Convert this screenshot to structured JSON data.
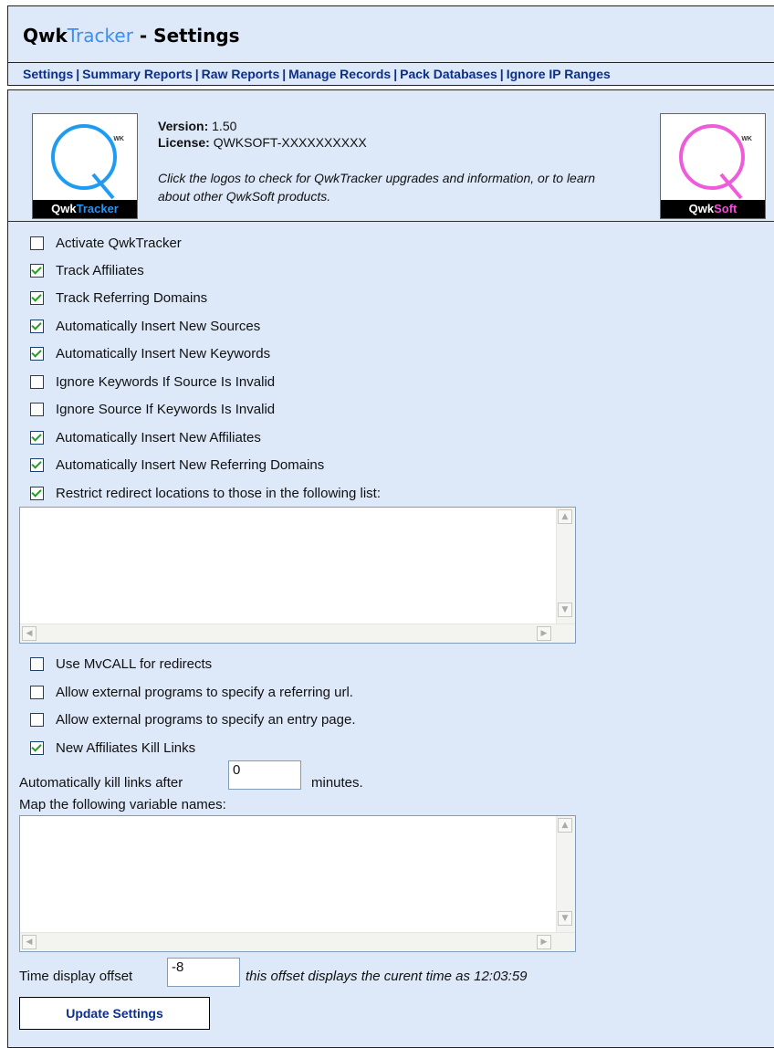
{
  "header": {
    "title_part1": "Qwk",
    "title_part2": "Tracker",
    "title_part3": " - Settings"
  },
  "nav": {
    "items": [
      "Settings",
      "Summary Reports",
      "Raw Reports",
      "Manage Records",
      "Pack Databases",
      "Ignore IP Ranges"
    ]
  },
  "info": {
    "version_label": "Version:",
    "version_value": "1.50",
    "license_label": "License:",
    "license_value": "QWKSOFT-XXXXXXXXXX",
    "note": "Click the logos to check for QwkTracker upgrades and information, or to learn about other QwkSoft products."
  },
  "logos": {
    "left": {
      "part1": "Qwk",
      "part2": "Tracker",
      "wk": "WK",
      "ring_color": "#1f9cf2"
    },
    "right": {
      "part1": "Qwk",
      "part2": "Soft",
      "wk": "WK",
      "ring_color": "#ef5cd9"
    }
  },
  "options": [
    {
      "label": "Activate QwkTracker",
      "checked": false
    },
    {
      "label": "Track Affiliates",
      "checked": true
    },
    {
      "label": "Track Referring Domains",
      "checked": true
    },
    {
      "label": "Automatically Insert New Sources",
      "checked": true
    },
    {
      "label": "Automatically Insert New Keywords",
      "checked": true
    },
    {
      "label": "Ignore Keywords If Source Is Invalid",
      "checked": false
    },
    {
      "label": "Ignore Source If Keywords Is Invalid",
      "checked": false
    },
    {
      "label": "Automatically Insert New Affiliates",
      "checked": true
    },
    {
      "label": "Automatically Insert New Referring Domains",
      "checked": true
    },
    {
      "label": "Restrict redirect locations to those in the following list:",
      "checked": true
    }
  ],
  "options2": [
    {
      "label": "Use MvCALL for redirects",
      "checked": false
    },
    {
      "label": "Allow external programs to specify a referring url.",
      "checked": false
    },
    {
      "label": "Allow external programs to specify an entry page.",
      "checked": false
    },
    {
      "label": "New Affiliates Kill Links",
      "checked": true
    }
  ],
  "kill": {
    "prefix": "Automatically kill links after",
    "value": "0",
    "suffix": "minutes."
  },
  "map_label": "Map the following variable names:",
  "time": {
    "prefix": "Time display offset",
    "value": "-8",
    "note": "this offset displays the curent time as 12:03:59"
  },
  "update_button": "Update Settings"
}
